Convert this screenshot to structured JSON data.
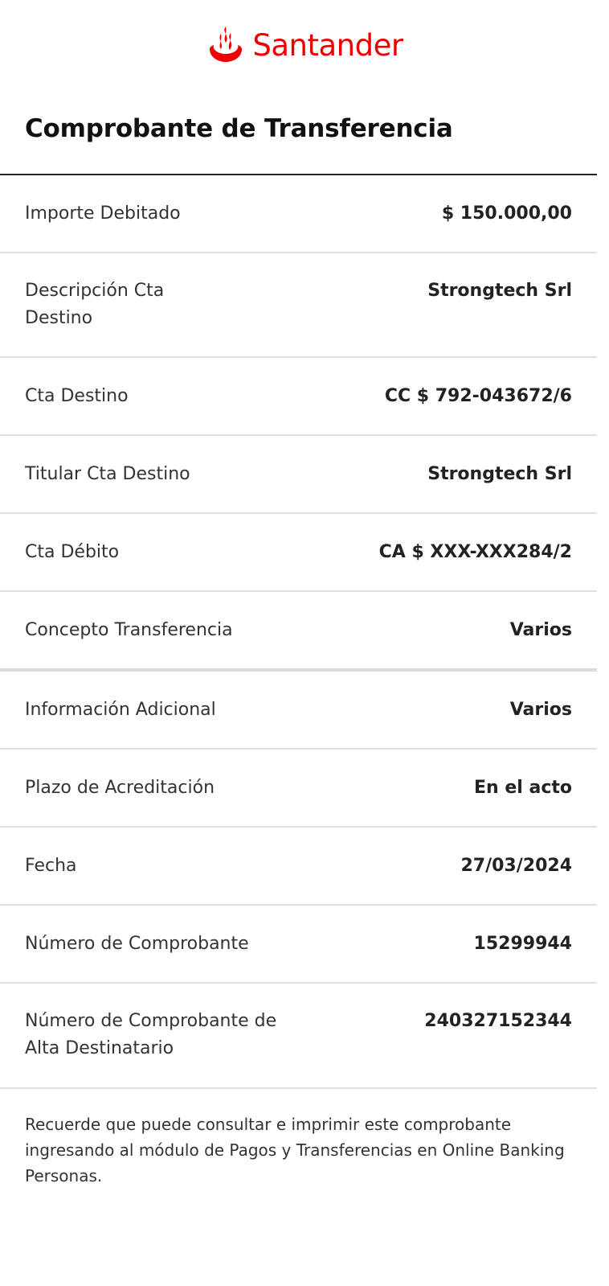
{
  "brand": {
    "name": "Santander",
    "color": "#ec0000",
    "icon": "santander-flame-icon"
  },
  "title": "Comprobante de Transferencia",
  "rows": [
    {
      "label": "Importe Debitado",
      "value": "$ 150.000,00"
    },
    {
      "label": "Descripción Cta Destino",
      "value": "Strongtech Srl"
    },
    {
      "label": "Cta Destino",
      "value": "CC $ 792-043672/6"
    },
    {
      "label": "Titular Cta Destino",
      "value": "Strongtech Srl"
    },
    {
      "label": "Cta Débito",
      "value": "CA $ XXX-XXX284/2"
    },
    {
      "label": "Concepto Transferencia",
      "value": "Varios"
    },
    {
      "label": "Información Adicional",
      "value": "Varios"
    },
    {
      "label": "Plazo de Acreditación",
      "value": "En el acto"
    },
    {
      "label": "Fecha",
      "value": "27/03/2024"
    },
    {
      "label": "Número de Comprobante",
      "value": "15299944"
    },
    {
      "label": "Número de Comprobante de Alta Destinatario",
      "value": "240327152344"
    }
  ],
  "footer_note": "Recuerde que puede consultar e imprimir este comprobante ingresando al módulo de Pagos y Transferencias en Online Banking Personas."
}
